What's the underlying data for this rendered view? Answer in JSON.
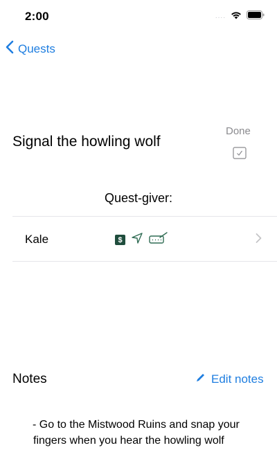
{
  "status_bar": {
    "time": "2:00",
    "signal": "....",
    "icons": [
      "wifi-icon",
      "battery-icon"
    ]
  },
  "nav": {
    "back_label": "Quests"
  },
  "quest": {
    "title": "Signal the howling wolf",
    "done_label": "Done",
    "done_checked": true,
    "giver_heading": "Quest-giver:",
    "giver": {
      "name": "Kale",
      "icons": [
        "dollar-icon",
        "navigation-arrow-icon",
        "keyboard-signature-icon"
      ]
    }
  },
  "notes": {
    "title": "Notes",
    "edit_label": "Edit notes",
    "body": "- Go to the Mistwood Ruins and snap your fingers when you hear the howling wolf"
  },
  "colors": {
    "accent": "#1f7ee0",
    "badge": "#1f4d3d",
    "icon_green": "#2f6b53",
    "secondary_text": "#8a8a8e"
  }
}
